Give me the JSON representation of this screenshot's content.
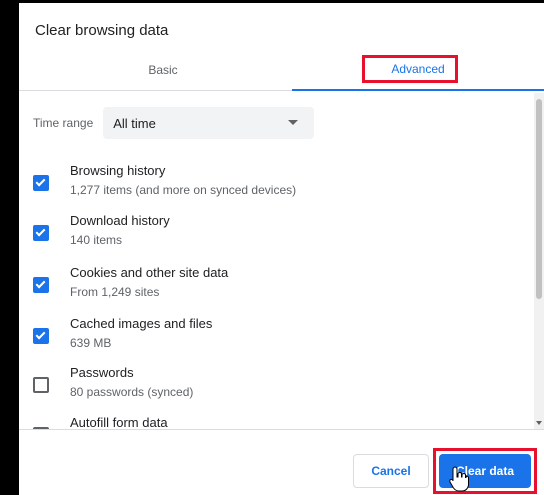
{
  "dialog": {
    "title": "Clear browsing data"
  },
  "tabs": [
    {
      "label": "Basic"
    },
    {
      "label": "Advanced"
    }
  ],
  "time_range": {
    "label": "Time range",
    "value": "All time"
  },
  "items": [
    {
      "title": "Browsing history",
      "subtitle": "1,277 items (and more on synced devices)",
      "checked": true
    },
    {
      "title": "Download history",
      "subtitle": "140 items",
      "checked": true
    },
    {
      "title": "Cookies and other site data",
      "subtitle": "From 1,249 sites",
      "checked": true
    },
    {
      "title": "Cached images and files",
      "subtitle": "639 MB",
      "checked": true
    },
    {
      "title": "Passwords",
      "subtitle": "80 passwords (synced)",
      "checked": false
    },
    {
      "title": "Autofill form data",
      "subtitle": "",
      "checked": false
    }
  ],
  "footer": {
    "cancel_label": "Cancel",
    "clear_label": "Clear data"
  },
  "colors": {
    "accent": "#1a73e8",
    "highlight": "#e8112d"
  },
  "icons": {
    "dropdown": "chevron-down-icon",
    "check": "checkmark-icon",
    "cursor": "hand-pointer-icon"
  }
}
